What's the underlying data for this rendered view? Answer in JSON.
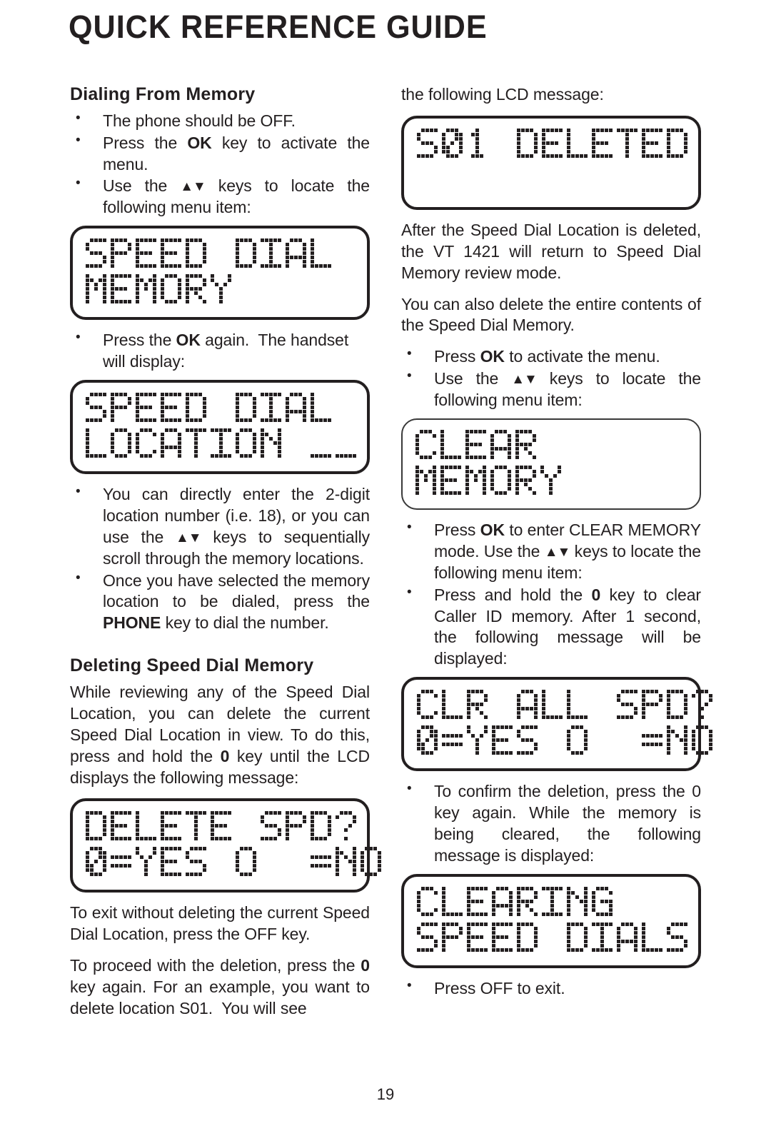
{
  "document": {
    "title": "QUICK REFERENCE GUIDE",
    "page_number": "19"
  },
  "left_column": {
    "heading_dialing": "Dialing From Memory",
    "bullets_dialing": [
      "The phone should be OFF.",
      "Press the OK key to activate the menu.",
      "Use the ▲▼ keys to locate the following menu item:"
    ],
    "lcd_speed_dial_memory": {
      "line1": "SPEED DIAL",
      "line2": "MEMORY"
    },
    "bullet_press_ok_again": "Press the OK again.  The handset will display:",
    "lcd_speed_dial_location": {
      "line1": "SPEED DIAL",
      "line2": "LOCATION __"
    },
    "bullets_locate": [
      "You can directly enter the 2-digit location number (i.e. 18), or you can use the ▲▼ keys to sequentially scroll through the memory locations.",
      "Once you have selected the memory location to be dialed, press the PHONE key to dial the number."
    ],
    "heading_deleting": "Deleting Speed Dial Memory",
    "para_while_reviewing": "While reviewing any of the Speed Dial Location, you can delete the current Speed Dial Location in view. To do this, press and hold the 0 key until the LCD displays the following message:",
    "lcd_delete_spd": {
      "line1": "DELETE SPD?",
      "line2": "0=YES OFF=NO"
    },
    "para_to_exit": "To exit without deleting the current Speed Dial Location, press the OFF key.",
    "para_to_proceed": "To proceed with the deletion, press the 0 key again. For an example, you want to delete location S01.  You will see"
  },
  "right_column": {
    "para_continuation": "the following LCD message:",
    "lcd_s01_deleted": {
      "line1": "S01 DELETED",
      "line2": ""
    },
    "para_after_deleted": "After the Speed Dial Location is deleted, the VT 1421 will return to Speed Dial Memory review mode.",
    "para_you_can_also": "You can also delete the entire contents of the Speed Dial Memory.",
    "bullets_clear": [
      "Press OK to activate the menu.",
      "Use the ▲▼ keys to locate the following menu item:"
    ],
    "lcd_clear_memory": {
      "line1": "CLEAR",
      "line2": "MEMORY"
    },
    "bullets_clear_mode": [
      "Press OK to enter CLEAR MEMORY mode. Use the ▲▼ keys to locate the following menu item:",
      "Press and hold the 0 key to clear Caller ID memory. After 1 second, the following message will be displayed:"
    ],
    "lcd_clr_all_spd": {
      "line1": "CLR ALL SPD?",
      "line2": "0=YES OFF=NO"
    },
    "bullet_confirm": "To confirm the deletion, press the 0 key again.  While the memory is being cleared, the following message is displayed:",
    "lcd_clearing": {
      "line1": "CLEARING",
      "line2": "SPEED DIALS"
    },
    "bullet_press_off": "Press OFF to exit."
  },
  "colors": {
    "ink": "#231f20",
    "paper": "#ffffff"
  }
}
